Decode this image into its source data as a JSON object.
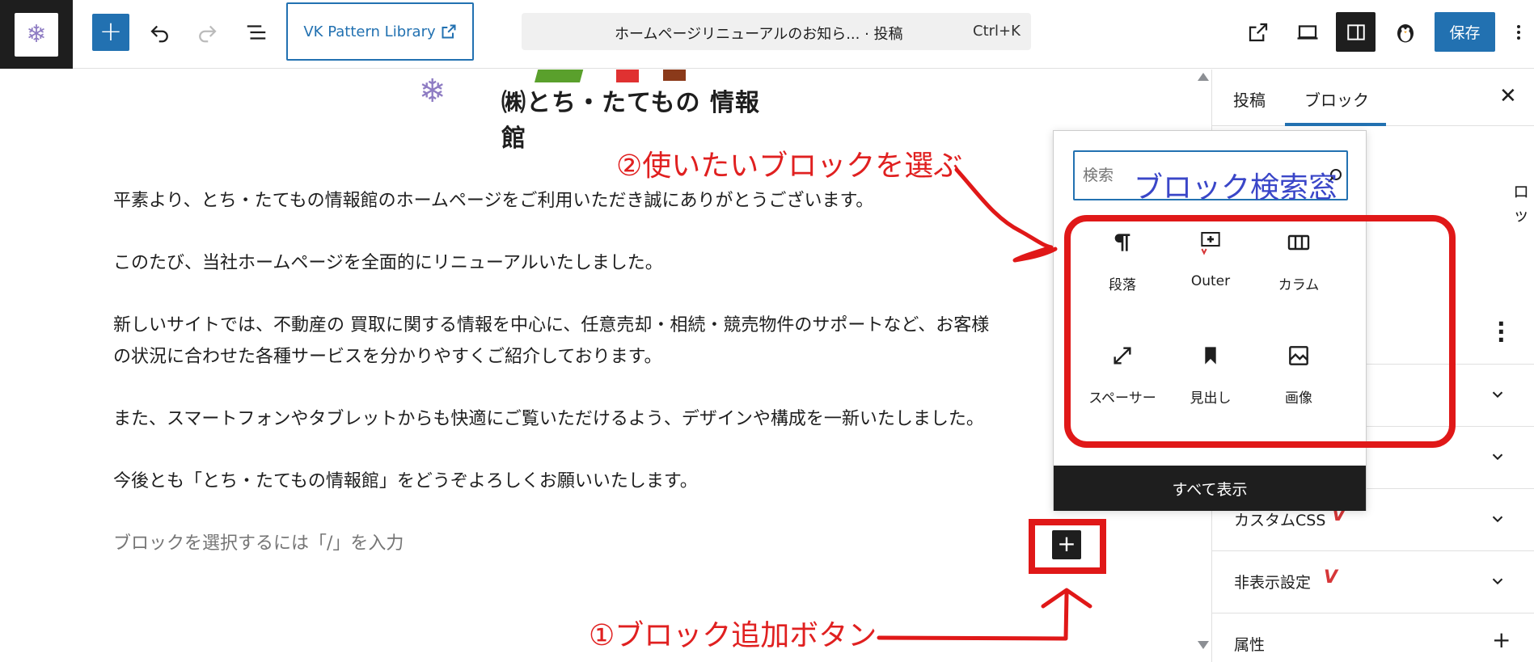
{
  "toolbar": {
    "add_block_label": "+",
    "pattern_library_label": "VK Pattern Library",
    "command_title": "ホームページリニューアルのお知ら... · 投稿",
    "command_shortcut": "Ctrl+K",
    "save_label": "保存"
  },
  "canvas": {
    "header_image_text": "㈱とち・たてもの 情報館",
    "paragraphs": [
      "平素より、とち・たてもの情報館のホームページをご利用いただき誠にありがとうございます。",
      "このたび、当社ホームページを全面的にリニューアルいたしました。",
      "新しいサイトでは、不動産の 買取に関する情報を中心に、任意売却・相続・競売物件のサポートなど、お客様",
      "の状況に合わせた各種サービスを分かりやすくご紹介しております。",
      "また、スマートフォンやタブレットからも快適にご覧いただけるよう、デザインや構成を一新いたしました。",
      "今後とも「とち・たてもの情報館」をどうぞよろしくお願いいたします。"
    ],
    "placeholder": "ブロックを選択するには「/」を入力",
    "inserter_label": "+"
  },
  "sidebar": {
    "tabs": [
      "投稿",
      "ブロック"
    ],
    "active_tab": "ブロック",
    "close_label": "✕",
    "fragment_text": "ロッ",
    "panels": [
      {
        "label": "カスタムCSS",
        "vk_badge": "V"
      },
      {
        "label": "非表示設定",
        "vk_badge": "V"
      },
      {
        "label": "属性",
        "toggle": "+"
      }
    ]
  },
  "inserter": {
    "search_placeholder": "検索",
    "blocks": [
      {
        "label": "段落",
        "icon": "paragraph-icon"
      },
      {
        "label": "Outer",
        "icon": "outer-icon"
      },
      {
        "label": "カラム",
        "icon": "columns-icon"
      },
      {
        "label": "スペーサー",
        "icon": "spacer-icon"
      },
      {
        "label": "見出し",
        "icon": "heading-icon"
      },
      {
        "label": "画像",
        "icon": "image-icon"
      }
    ],
    "browse_all_label": "すべて表示"
  },
  "annotations": {
    "choose_block": "②使いたいブロックを選ぶ",
    "search_window": "ブロック検索窓",
    "add_block_button": "①ブロック追加ボタン",
    "color_red": "#e01818",
    "color_blue": "#3a46c8"
  },
  "colors": {
    "accent": "#2271b1",
    "dark": "#1e1e1e"
  }
}
